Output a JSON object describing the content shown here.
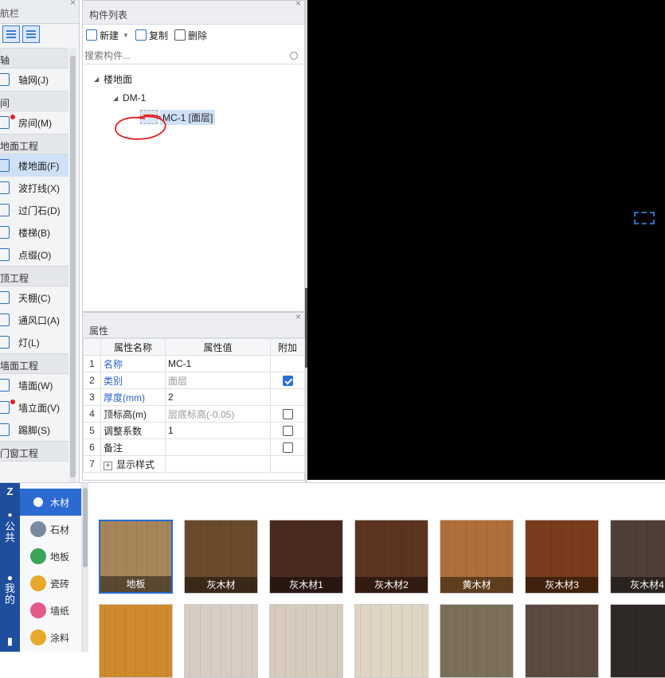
{
  "nav": {
    "title": "航栏",
    "close": "×",
    "list": [
      {
        "type": "cat",
        "label": "轴"
      },
      {
        "type": "item",
        "label": "轴网(J)",
        "dot": false,
        "active": false,
        "icon": "axis-grid-icon"
      },
      {
        "type": "cat",
        "label": "间"
      },
      {
        "type": "item",
        "label": "房间(M)",
        "dot": true,
        "active": false,
        "icon": "room-icon"
      },
      {
        "type": "cat",
        "label": "地面工程"
      },
      {
        "type": "item",
        "label": "楼地面(F)",
        "dot": false,
        "active": true,
        "icon": "floor-icon"
      },
      {
        "type": "item",
        "label": "波打线(X)",
        "dot": false,
        "active": false,
        "icon": "border-line-icon"
      },
      {
        "type": "item",
        "label": "过门石(D)",
        "dot": false,
        "active": false,
        "icon": "threshold-stone-icon"
      },
      {
        "type": "item",
        "label": "楼梯(B)",
        "dot": false,
        "active": false,
        "icon": "stairs-icon"
      },
      {
        "type": "item",
        "label": "点缀(O)",
        "dot": false,
        "active": false,
        "icon": "ornament-icon"
      },
      {
        "type": "cat",
        "label": "顶工程"
      },
      {
        "type": "item",
        "label": "天棚(C)",
        "dot": false,
        "active": false,
        "icon": "ceiling-icon"
      },
      {
        "type": "item",
        "label": "通风口(A)",
        "dot": false,
        "active": false,
        "icon": "vent-icon"
      },
      {
        "type": "item",
        "label": "灯(L)",
        "dot": false,
        "active": false,
        "icon": "lamp-icon"
      },
      {
        "type": "cat",
        "label": "墙面工程"
      },
      {
        "type": "item",
        "label": "墙面(W)",
        "dot": false,
        "active": false,
        "icon": "wall-icon"
      },
      {
        "type": "item",
        "label": "墙立面(V)",
        "dot": true,
        "active": false,
        "icon": "wall-elevation-icon"
      },
      {
        "type": "item",
        "label": "踢脚(S)",
        "dot": false,
        "active": false,
        "icon": "skirting-icon"
      },
      {
        "type": "cat",
        "label": "门窗工程"
      }
    ]
  },
  "components": {
    "title": "构件列表",
    "close": "×",
    "toolbar": {
      "new": "新建",
      "copy": "复制",
      "delete": "删除"
    },
    "search_placeholder": "搜索构件...",
    "tree": {
      "root": "楼地面",
      "child": "DM-1",
      "leaf": "MC-1 [面层]"
    }
  },
  "props": {
    "title": "属性",
    "close": "×",
    "headers": [
      "属性名称",
      "属性值",
      "附加"
    ],
    "rows": [
      {
        "n": "1",
        "name": "名称",
        "value": "MC-1",
        "blue": true,
        "gray": false,
        "check": "none"
      },
      {
        "n": "2",
        "name": "类别",
        "value": "面层",
        "blue": true,
        "gray": true,
        "check": "on"
      },
      {
        "n": "3",
        "name": "厚度(mm)",
        "value": "2",
        "blue": true,
        "gray": false,
        "check": "none"
      },
      {
        "n": "4",
        "name": "顶标高(m)",
        "value": "层底标高(-0.05)",
        "blue": false,
        "gray": true,
        "check": "off"
      },
      {
        "n": "5",
        "name": "调整系数",
        "value": "1",
        "blue": false,
        "gray": false,
        "check": "off"
      },
      {
        "n": "6",
        "name": "备注",
        "value": "",
        "blue": false,
        "gray": false,
        "check": "off"
      },
      {
        "n": "7",
        "name": "显示样式",
        "value": "",
        "blue": false,
        "gray": false,
        "check": "none",
        "expand": true
      }
    ]
  },
  "materials": {
    "side": [
      "Z",
      "公\n共",
      "我\n的"
    ],
    "categories": [
      {
        "label": "木材",
        "active": true,
        "color": "#2b6bd1",
        "icon": "wood-icon"
      },
      {
        "label": "石材",
        "active": false,
        "color": "#7a8aa0",
        "icon": "stone-icon"
      },
      {
        "label": "地板",
        "active": false,
        "color": "#3aa55a",
        "icon": "floorboard-icon"
      },
      {
        "label": "瓷砖",
        "active": false,
        "color": "#e8a92a",
        "icon": "tile-icon"
      },
      {
        "label": "墙纸",
        "active": false,
        "color": "#e25a8a",
        "icon": "wallpaper-icon"
      },
      {
        "label": "涂料",
        "active": false,
        "color": "#e8a92a",
        "icon": "paint-icon"
      }
    ],
    "tiles_row1": [
      {
        "label": "地板",
        "color": "#a5865a",
        "selected": true
      },
      {
        "label": "灰木材",
        "color": "#6b4a2c",
        "selected": false
      },
      {
        "label": "灰木材1",
        "color": "#4a2a1e",
        "selected": false
      },
      {
        "label": "灰木材2",
        "color": "#5c3420",
        "selected": false
      },
      {
        "label": "黄木材",
        "color": "#b06f3a",
        "selected": false
      },
      {
        "label": "灰木材3",
        "color": "#7a3c1c",
        "selected": false
      },
      {
        "label": "灰木材4",
        "color": "#4e4038",
        "selected": false
      }
    ],
    "tiles_row2": [
      {
        "color": "#cf8a2e"
      },
      {
        "color": "#d8cdc2"
      },
      {
        "color": "#d7cbbd"
      },
      {
        "color": "#e0d5c4"
      },
      {
        "color": "#7a6f58"
      },
      {
        "color": "#5a4a40"
      },
      {
        "color": "#2e2826"
      }
    ]
  }
}
